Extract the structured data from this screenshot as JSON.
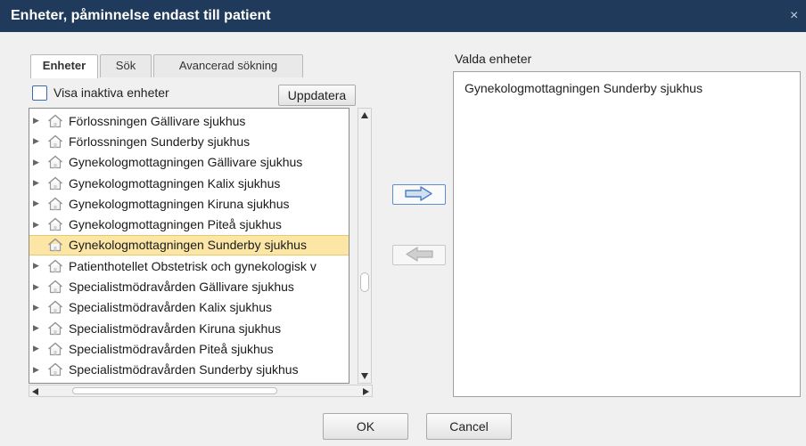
{
  "window": {
    "title": "Enheter, påminnelse endast till patient",
    "close_glyph": "×"
  },
  "tabs": [
    {
      "label": "Enheter",
      "active": true
    },
    {
      "label": "Sök",
      "active": false
    },
    {
      "label": "Avancerad sökning",
      "active": false
    }
  ],
  "filter": {
    "show_inactive_label": "Visa inaktiva enheter",
    "show_inactive_checked": false,
    "refresh_label": "Uppdatera"
  },
  "tree": {
    "icon": "house-icon",
    "items": [
      {
        "label": "Förlossningen Gällivare sjukhus",
        "selected": false
      },
      {
        "label": "Förlossningen Sunderby sjukhus",
        "selected": false
      },
      {
        "label": "Gynekologmottagningen Gällivare sjukhus",
        "selected": false
      },
      {
        "label": "Gynekologmottagningen Kalix sjukhus",
        "selected": false
      },
      {
        "label": "Gynekologmottagningen Kiruna sjukhus",
        "selected": false
      },
      {
        "label": "Gynekologmottagningen Piteå sjukhus",
        "selected": false
      },
      {
        "label": "Gynekologmottagningen Sunderby sjukhus",
        "selected": true
      },
      {
        "label": "Patienthotellet Obstetrisk och gynekologisk v",
        "selected": false
      },
      {
        "label": "Specialistmödravården Gällivare sjukhus",
        "selected": false
      },
      {
        "label": "Specialistmödravården Kalix sjukhus",
        "selected": false
      },
      {
        "label": "Specialistmödravården Kiruna sjukhus",
        "selected": false
      },
      {
        "label": "Specialistmödravården Piteå sjukhus",
        "selected": false
      },
      {
        "label": "Specialistmödravården Sunderby sjukhus",
        "selected": false
      }
    ]
  },
  "selected_units": {
    "label": "Valda enheter",
    "items": [
      "Gynekologmottagningen Sunderby sjukhus"
    ]
  },
  "footer": {
    "ok_label": "OK",
    "cancel_label": "Cancel"
  },
  "colors": {
    "titlebar": "#1f3a5a",
    "selection": "#fbe6a6",
    "arrow_active": "#5b8fcf",
    "arrow_disabled": "#b8b8b8"
  }
}
